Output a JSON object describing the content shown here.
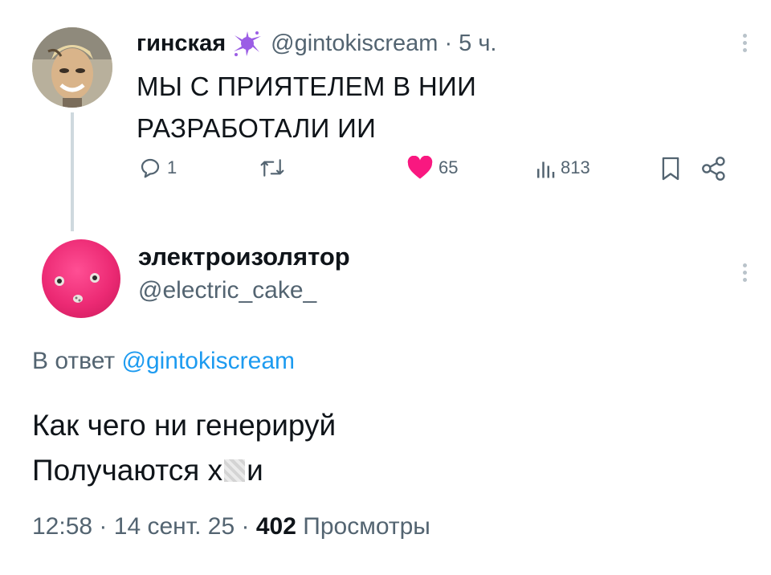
{
  "tweet1": {
    "display_name": "гинская",
    "handle": "@gintokiscream",
    "separator": "·",
    "time": "5 ч.",
    "text_line1": "МЫ С ПРИЯТЕЛЕМ В НИИ",
    "text_line2": "РАЗРАБОТАЛИ ИИ",
    "replies": "1",
    "likes": "65",
    "views": "813",
    "like_color": "#f91880"
  },
  "tweet2": {
    "display_name": "электроизолятор",
    "handle": "@electric_cake_",
    "reply_prefix": "В ответ",
    "reply_handle": "@gintokiscream",
    "text_line1": "Как чего ни генерируй",
    "text_line2_start": "Получаются х",
    "text_line2_end": "и",
    "time": "12:58",
    "sep1": "·",
    "date": "14 сент. 25",
    "sep2": "·",
    "views_count": "402",
    "views_label": "Просмотры"
  },
  "colors": {
    "text": "#0f1419",
    "muted": "#536471",
    "link": "#1d9bf0",
    "thread_line": "#cfd9de"
  },
  "icons": [
    "more-dots-icon",
    "reply-icon",
    "retweet-icon",
    "heart-icon",
    "views-icon",
    "bookmark-icon",
    "share-icon",
    "purple-splat-emoji"
  ]
}
